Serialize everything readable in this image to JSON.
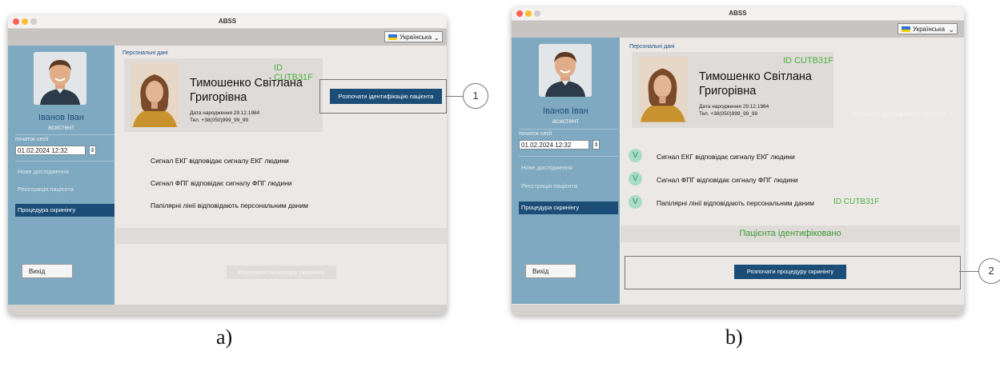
{
  "screens": [
    {
      "window_title": "ABSS",
      "language": "Українська",
      "sidebar": {
        "user_name": "Іванов Іван",
        "user_role": "асистент",
        "session_label": "початок сесії",
        "session_value": "01.02.2024 12:32",
        "nav": [
          "Нове дослідження",
          "Реєстрація пацієнта",
          "Процедура скринінгу"
        ],
        "exit": "Вихід"
      },
      "section_title": "Персональні дані",
      "patient": {
        "id": "ID CUTB31F",
        "name_line1": "Тимошенко Світлана",
        "name_line2": "Григорівна",
        "dob": "Дата народження  29.12.1984",
        "phone": "Тел.  +38(050)999_99_99"
      },
      "identify_button": "Розпочати ідентифікацію пацієнта",
      "signals": [
        "Сигнал ЕКГ відповідає сигналу ЕКГ людини",
        "Сигнал ФПГ відповідає сигналу ФПГ людини",
        "Папілярні лінії відповідають персональним даним"
      ],
      "start_button": "Розпочати процедуру скринінгу",
      "callout": "1",
      "caption": "a)"
    },
    {
      "window_title": "ABSS",
      "language": "Українська",
      "sidebar": {
        "user_name": "Іванов Іван",
        "user_role": "асистент",
        "session_label": "початок сесії",
        "session_value": "01.02.2024 12:32",
        "nav": [
          "Нове дослідження",
          "Реєстрація пацієнта",
          "Процедура скринінгу"
        ],
        "exit": "Вихід"
      },
      "section_title": "Персональні дані",
      "patient": {
        "id": "ID CUTB31F",
        "name_line1": "Тимошенко Світлана",
        "name_line2": "Григорівна",
        "dob": "Дата народження  29.12.1984",
        "phone": "Тел.  +38(050)999_99_99"
      },
      "identify_button": "Розпочати ідентифікацію пацієнта",
      "signals": [
        "Сигнал ЕКГ відповідає сигналу ЕКГ людини",
        "Сигнал ФПГ відповідає сигналу ФПГ людини",
        "Папілярні лінії відповідають персональним даним"
      ],
      "match_id": "ID CUTB31F",
      "check_glyph": "V",
      "identified_banner": "Пацієнта ідентифіковано",
      "start_button": "Розпочати процедуру скринінгу",
      "callout": "2",
      "caption": "b)"
    }
  ],
  "colors": {
    "accent": "#1c4d76",
    "sidebar": "#7fa9c0",
    "success": "#4ab33d",
    "check_bg": "#a8dcc7"
  },
  "icons": {
    "window_controls": [
      "close-dot",
      "minimize-dot",
      "zoom-dot"
    ],
    "language_flag": "ukraine-flag-icon",
    "dropdown": "chevron-down-icon",
    "stepper": "stepper-icon",
    "check": "check-circle-icon"
  }
}
